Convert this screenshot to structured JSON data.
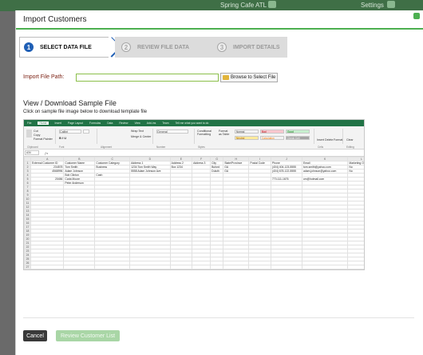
{
  "background": {
    "location": "Spring Cafe ATL",
    "settings": "Settings"
  },
  "modal": {
    "title": "Import Customers"
  },
  "wizard": {
    "steps": [
      {
        "number": "1",
        "label": "SELECT DATA FILE",
        "state": "active"
      },
      {
        "number": "2",
        "label": "REVIEW FILE DATA",
        "state": "inactive"
      },
      {
        "number": "3",
        "label": "IMPORT DETAILS",
        "state": "inactive"
      }
    ]
  },
  "file_path": {
    "label": "Import File Path:",
    "value": "",
    "browse_label": "Browse to Select File"
  },
  "sample": {
    "title": "View / Download Sample File",
    "instructions": "Click on sample file image below to download template file"
  },
  "excel": {
    "menu_tabs": [
      "File",
      "Home",
      "Insert",
      "Page Layout",
      "Formulas",
      "Data",
      "Review",
      "View",
      "Add-ins",
      "Team",
      "Tell me what you want to do"
    ],
    "ribbon_groups": [
      "Clipboard",
      "Font",
      "Alignment",
      "Number",
      "Styles",
      "Cells",
      "Editing"
    ],
    "clipboard_items": [
      "Cut",
      "Copy",
      "Format Painter"
    ],
    "font_name": "Calibri",
    "wrap_text": "Wrap Text",
    "merge_center": "Merge & Center",
    "number_format": "General",
    "conditional_formatting": "Conditional Formatting",
    "format_as_table": "Format as Table",
    "styles": [
      {
        "label": "Normal",
        "color": "#ffffff"
      },
      {
        "label": "Bad",
        "color": "#ffc7ce"
      },
      {
        "label": "Good",
        "color": "#c6efce"
      },
      {
        "label": "Neutral",
        "color": "#ffeb9c"
      },
      {
        "label": "Calculation",
        "color": "#f2f2f2"
      },
      {
        "label": "Check Cell",
        "color": "#a5a5a5"
      }
    ],
    "cells_items": [
      "Insert",
      "Delete",
      "Format"
    ],
    "editing_items": [
      "Clear"
    ],
    "name_box": "A34",
    "columns": [
      "A",
      "B",
      "C",
      "D",
      "E",
      "F",
      "G",
      "H",
      "I",
      "J",
      "K",
      "L",
      "M"
    ],
    "rows": [
      [
        "External Customer ID",
        "Customer Name",
        "Customer Category",
        "Address 1",
        "Address 2",
        "Address 3",
        "City",
        "State/Province",
        "Postal Code",
        "Phone",
        "Email",
        "Marketing Opt Out",
        "Loyalty Balance"
      ],
      [
        "234578",
        "Tom Smith",
        "Business",
        "1234 Tom Smith Way",
        "Box 1234",
        "",
        "Buford",
        "GA",
        "",
        "(404) 404-123-5555",
        "tom.smith@yahoo.com",
        "No",
        "160"
      ],
      [
        "4568996",
        "Adam Johnson",
        "",
        "5558 Adam Johnson Ave",
        "",
        "",
        "Duluth",
        "GA",
        "",
        "(404) 678-122-5555",
        "adam.johnson@yahoo.com",
        "No",
        ""
      ],
      [
        "",
        "Bob Clinton",
        "Cash",
        "",
        "",
        "",
        "",
        "",
        "",
        "",
        "",
        "",
        ""
      ],
      [
        "20456",
        "Carla Moore",
        "",
        "",
        "",
        "",
        "",
        "",
        "",
        "770-111-1676",
        "cm@hotmail.com",
        "",
        ""
      ],
      [
        "",
        "Peter Anderson",
        "",
        "",
        "",
        "",
        "",
        "",
        "",
        "",
        "",
        "",
        ""
      ]
    ],
    "empty_rows": 25
  },
  "footer": {
    "cancel_label": "Cancel",
    "review_label": "Review Customer List"
  },
  "colors": {
    "accent": "#4caf50",
    "active_step": "#1f5fb5",
    "excel_green": "#217346",
    "label_red": "#7a1e10"
  }
}
